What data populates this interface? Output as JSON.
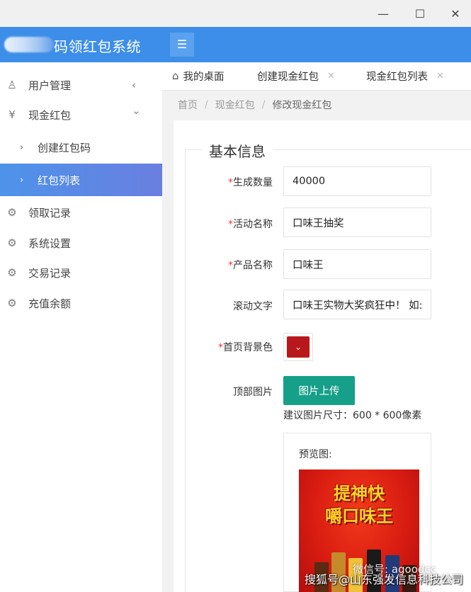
{
  "window": {
    "minimize": "—",
    "maximize": "☐",
    "close": "✕"
  },
  "header": {
    "title": "码领红包系统",
    "menu_icon": "☰"
  },
  "sidebar": {
    "items": [
      {
        "icon": "user-icon",
        "glyph": "♙",
        "label": "用户管理",
        "arrow": "‹"
      },
      {
        "icon": "yen-icon",
        "glyph": "¥",
        "label": "现金红包",
        "arrow": "⌄"
      },
      {
        "icon": "caret-right-icon",
        "glyph": "›",
        "label": "创建红包码"
      },
      {
        "icon": "caret-right-icon",
        "glyph": "›",
        "label": "红包列表",
        "active": true
      },
      {
        "icon": "gear-icon",
        "glyph": "⚙",
        "label": "领取记录"
      },
      {
        "icon": "gear-icon",
        "glyph": "⚙",
        "label": "系统设置"
      },
      {
        "icon": "gear-icon",
        "glyph": "⚙",
        "label": "交易记录"
      },
      {
        "icon": "gear-icon",
        "glyph": "⚙",
        "label": "充值余额"
      }
    ]
  },
  "tabs": [
    {
      "label": "我的桌面",
      "icon": "home-icon"
    },
    {
      "label": "创建现金红包",
      "closable": true
    },
    {
      "label": "现金红包列表",
      "closable": true
    }
  ],
  "breadcrumb": {
    "home": "首页",
    "section": "现金红包",
    "current": "修改现金红包",
    "sep": "/"
  },
  "form": {
    "legend": "基本信息",
    "fields": {
      "quantity": {
        "label": "生成数量",
        "required": true,
        "value": "40000"
      },
      "activity_name": {
        "label": "活动名称",
        "required": true,
        "value": "口味王抽奖"
      },
      "product_name": {
        "label": "产品名称",
        "required": true,
        "value": "口味王"
      },
      "scroll_text": {
        "label": "滚动文字",
        "required": false,
        "value": "口味王实物大奖疯狂中！ 如:"
      },
      "bg_color": {
        "label": "首页背景色",
        "required": true,
        "value": "#b8181c"
      },
      "top_image": {
        "label": "顶部图片",
        "required": false
      }
    },
    "upload_button": "图片上传",
    "size_hint": "建议图片尺寸：600 * 600像素",
    "preview_label": "预览图:",
    "preview_poster": {
      "line1": "提神快",
      "line2": "嚼口味王"
    }
  },
  "watermark": {
    "line1": "微信号: agoodcc",
    "line2": "搜狐号@山东强发信息科技公司"
  }
}
